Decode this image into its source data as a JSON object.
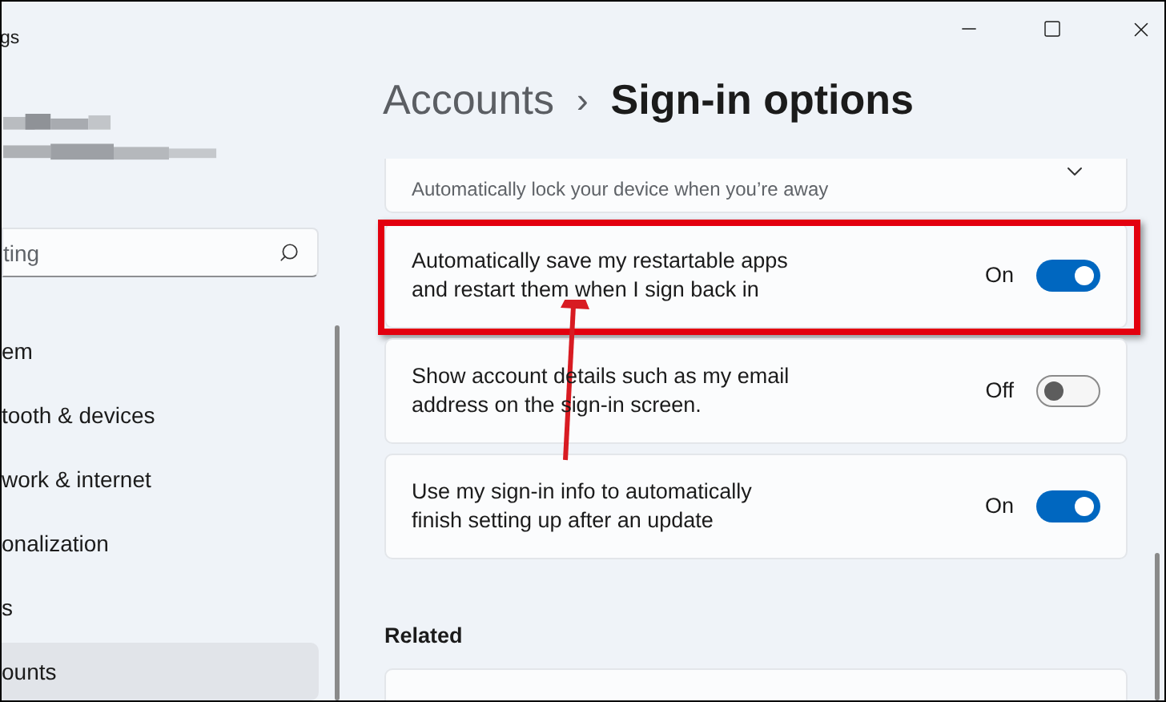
{
  "window": {
    "title": "gs"
  },
  "sidebar": {
    "search": {
      "placeholder": "ting"
    },
    "items": [
      {
        "label": "em",
        "selected": false
      },
      {
        "label": "tooth & devices",
        "selected": false
      },
      {
        "label": "work & internet",
        "selected": false
      },
      {
        "label": "onalization",
        "selected": false
      },
      {
        "label": "s",
        "selected": false
      },
      {
        "label": "ounts",
        "selected": true
      }
    ]
  },
  "breadcrumb": {
    "parent": "Accounts",
    "separator": "›",
    "current": "Sign-in options"
  },
  "settings": [
    {
      "kind": "expander",
      "subtitle": "Automatically lock your device when you’re away",
      "highlighted": false
    },
    {
      "kind": "toggle",
      "label": "Automatically save my restartable apps\nand restart them when I sign back in",
      "state_label": "On",
      "on": true,
      "highlighted": true
    },
    {
      "kind": "toggle",
      "label": "Show account details such as my email\naddress on the sign-in screen.",
      "state_label": "Off",
      "on": false,
      "highlighted": false
    },
    {
      "kind": "toggle",
      "label": "Use my sign-in info to automatically\nfinish setting up after an update",
      "state_label": "On",
      "on": true,
      "highlighted": false
    }
  ],
  "related": {
    "heading": "Related"
  }
}
